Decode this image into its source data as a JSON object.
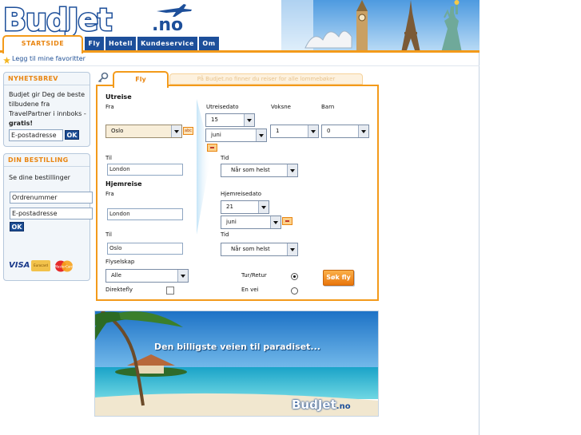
{
  "brand": {
    "logo_text": "BudJet",
    "logo_suffix": ".no"
  },
  "nav": {
    "tabs": [
      {
        "label": "STARTSIDE",
        "active": true
      },
      {
        "label": "Fly"
      },
      {
        "label": "Hotell"
      },
      {
        "label": "Kundeservice"
      },
      {
        "label": "Om"
      }
    ]
  },
  "favorites": {
    "label": "Legg til mine favoritter"
  },
  "newsletter": {
    "title": "NYHETSBREV",
    "text": "Budjet gir Deg de beste tilbudene fra TravelPartner i innboks - ",
    "text_bold": "gratis!",
    "email_value": "E-postadresse",
    "ok_label": "OK"
  },
  "booking": {
    "title": "DIN BESTILLING",
    "text": "Se dine bestillinger",
    "order_value": "Ordrenummer",
    "email_value": "E-postadresse",
    "ok_label": "OK"
  },
  "payment": {
    "cards": [
      "VISA",
      "Eurocard",
      "MasterCard"
    ]
  },
  "search": {
    "tab_label": "Fly",
    "banner_text": "På Budjet.no finner du reiser for alle lommebøker",
    "outbound_heading": "Utreise",
    "return_heading": "Hjemreise",
    "from_label": "Fra",
    "from_value": "Oslo",
    "to_label": "Til",
    "to_value": "London",
    "depart_date_label": "Utreisedato",
    "depart_day": "15",
    "depart_month": "juni",
    "adults_label": "Voksne",
    "adults_value": "1",
    "children_label": "Barn",
    "children_value": "0",
    "time_label": "Tid",
    "time_value": "Når som helst",
    "ret_from_label": "Fra",
    "ret_from_value": "London",
    "ret_to_label": "Til",
    "ret_to_value": "Oslo",
    "return_date_label": "Hjemreisedato",
    "return_day": "21",
    "return_month": "juni",
    "ret_time_label": "Tid",
    "ret_time_value": "Når som helst",
    "airline_label": "Flyselskap",
    "airline_value": "Alle",
    "direct_label": "Direktefly",
    "roundtrip_label": "Tur/Retur",
    "oneway_label": "En vei",
    "submit_label": "Søk fly"
  },
  "ad": {
    "headline": "Den billigste veien til paradiset...",
    "logo_text": "BudJet",
    "logo_suffix": ".no"
  },
  "colors": {
    "brand_blue": "#1d4f9a",
    "accent_orange": "#f39a1a",
    "sky": "#3a8fd9"
  }
}
